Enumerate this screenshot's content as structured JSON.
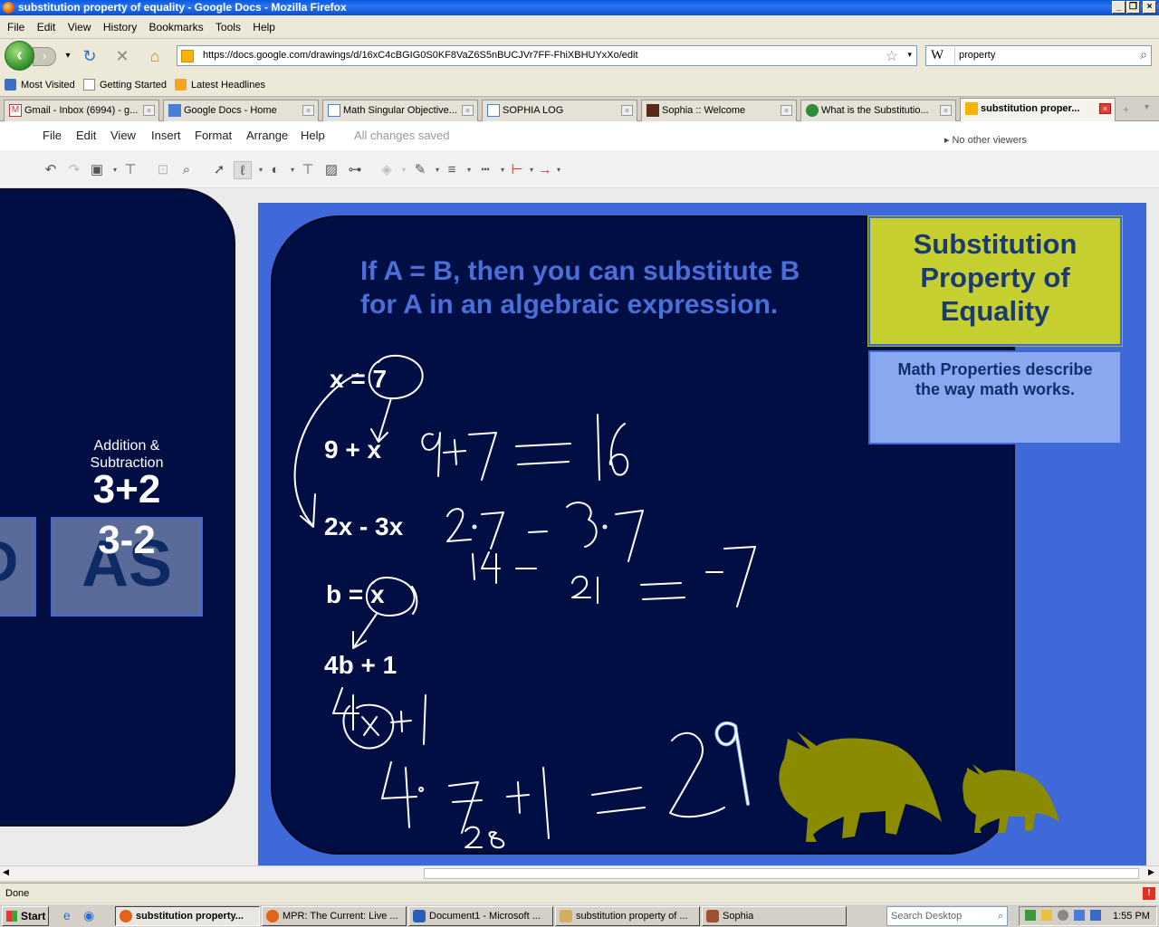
{
  "window": {
    "title": "substitution property of equality - Google Docs - Mozilla Firefox"
  },
  "firefox_menu": [
    "File",
    "Edit",
    "View",
    "History",
    "Bookmarks",
    "Tools",
    "Help"
  ],
  "nav": {
    "url": "https://docs.google.com/drawings/d/16xC4cBGIG0S0KF8VaZ6S5nBUCJVr7FF-FhiXBHUYxXo/edit",
    "search_engine": "W",
    "search_value": "property"
  },
  "bookmarks": [
    "Most Visited",
    "Getting Started",
    "Latest Headlines"
  ],
  "tabs": [
    {
      "label": "Gmail - Inbox (6994) - g...",
      "icon": "gmail-icon"
    },
    {
      "label": "Google Docs - Home",
      "icon": "docs-icon"
    },
    {
      "label": "Math Singular Objective...",
      "icon": "doc-icon"
    },
    {
      "label": "SOPHIA LOG",
      "icon": "doc-icon"
    },
    {
      "label": "Sophia :: Welcome",
      "icon": "sophia-icon"
    },
    {
      "label": "What is the Substitutio...",
      "icon": "power-icon"
    },
    {
      "label": "substitution proper...",
      "icon": "drawing-icon"
    }
  ],
  "docs_menu": [
    "File",
    "Edit",
    "View",
    "Insert",
    "Format",
    "Arrange",
    "Help"
  ],
  "docs_status": "All changes saved",
  "viewers": "No other viewers",
  "left_slide": {
    "big_text": "AS",
    "partial_text": "D",
    "caption_line1": "Addition &",
    "caption_line2": "Subtraction",
    "ex1": "3+2",
    "ex2": "3-2"
  },
  "slide": {
    "heading_line1": "If A = B, then you can substitute B",
    "heading_line2": "for A in an algebraic expression.",
    "eq1": "x = 7",
    "eq2": "9 + x",
    "eq3": "2x - 3x",
    "eq4": "b = x",
    "eq5": "4b + 1",
    "note_title_line1": "Substitution",
    "note_title_line2": "Property of",
    "note_title_line3": "Equality",
    "note_body_line1": "Math Properties describe",
    "note_body_line2": "the way math works."
  },
  "status": "Done",
  "taskbar": {
    "start": "Start",
    "tasks": [
      "substitution property...",
      "MPR: The Current: Live ...",
      "Document1 - Microsoft ...",
      "substitution property of ...",
      "Sophia"
    ],
    "search_placeholder": "Search Desktop",
    "clock": "1:55 PM"
  },
  "colors": {
    "slide_bg": "#3f69d8",
    "board": "#000e43",
    "note_yellow": "#c5cf30",
    "dino": "#8b8b00"
  }
}
